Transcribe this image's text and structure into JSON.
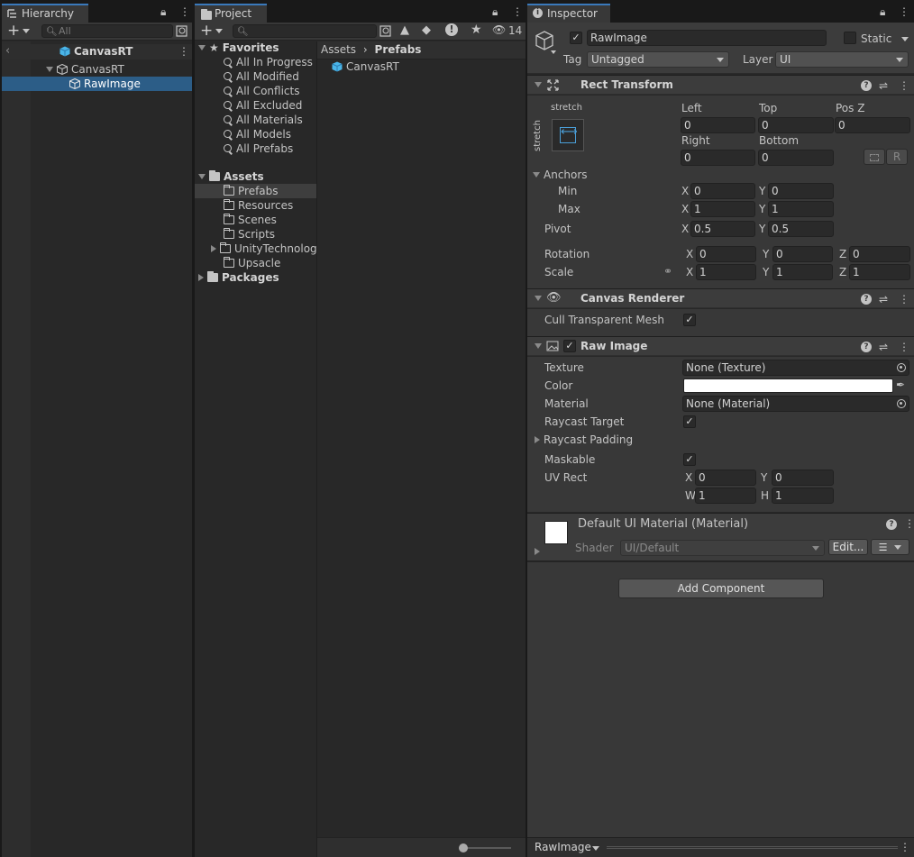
{
  "hierarchy": {
    "tab_title": "Hierarchy",
    "search_placeholder": "All",
    "scene_root": "CanvasRT",
    "items": [
      "CanvasRT",
      "RawImage"
    ]
  },
  "project": {
    "tab_title": "Project",
    "hidden_count": "14",
    "favorites_title": "Favorites",
    "favorites": [
      "All In Progress",
      "All Modified",
      "All Conflicts",
      "All Excluded",
      "All Materials",
      "All Models",
      "All Prefabs"
    ],
    "assets_title": "Assets",
    "asset_folders": [
      "Prefabs",
      "Resources",
      "Scenes",
      "Scripts",
      "UnityTechnologies",
      "Upsacle"
    ],
    "packages_title": "Packages",
    "breadcrumb": [
      "Assets",
      "Prefabs"
    ],
    "files": [
      "CanvasRT"
    ]
  },
  "inspector": {
    "tab_title": "Inspector",
    "object_name": "RawImage",
    "static_label": "Static",
    "tag_label": "Tag",
    "tag_value": "Untagged",
    "layer_label": "Layer",
    "layer_value": "UI",
    "rect_transform": {
      "title": "Rect Transform",
      "anchor_preset_top": "stretch",
      "anchor_preset_side": "stretch",
      "left_label": "Left",
      "left": "0",
      "top_label": "Top",
      "top": "0",
      "posz_label": "Pos Z",
      "posz": "0",
      "right_label": "Right",
      "right": "0",
      "bottom_label": "Bottom",
      "bottom": "0",
      "r_button": "R",
      "anchors_label": "Anchors",
      "min_label": "Min",
      "min_x": "0",
      "min_y": "0",
      "max_label": "Max",
      "max_x": "1",
      "max_y": "1",
      "pivot_label": "Pivot",
      "pivot_x": "0.5",
      "pivot_y": "0.5",
      "rotation_label": "Rotation",
      "rot_x": "0",
      "rot_y": "0",
      "rot_z": "0",
      "scale_label": "Scale",
      "scale_x": "1",
      "scale_y": "1",
      "scale_z": "1",
      "x": "X",
      "y": "Y",
      "z": "Z"
    },
    "canvas_renderer": {
      "title": "Canvas Renderer",
      "cull_label": "Cull Transparent Mesh"
    },
    "raw_image": {
      "title": "Raw Image",
      "texture_label": "Texture",
      "texture_value": "None (Texture)",
      "color_label": "Color",
      "color_value": "#ffffff",
      "material_label": "Material",
      "material_value": "None (Material)",
      "raycast_target_label": "Raycast Target",
      "raycast_padding_label": "Raycast Padding",
      "maskable_label": "Maskable",
      "uvrect_label": "UV Rect",
      "uv_x": "0",
      "uv_y": "0",
      "uv_w": "1",
      "uv_h": "1",
      "w": "W",
      "h": "H"
    },
    "material": {
      "title": "Default UI Material (Material)",
      "shader_label": "Shader",
      "shader_value": "UI/Default",
      "edit_button": "Edit..."
    },
    "add_component": "Add Component",
    "footer_label": "RawImage"
  },
  "colors": {
    "accent": "#3a79bb",
    "selection": "#2c5d87",
    "cube": "#4ab5e8"
  }
}
